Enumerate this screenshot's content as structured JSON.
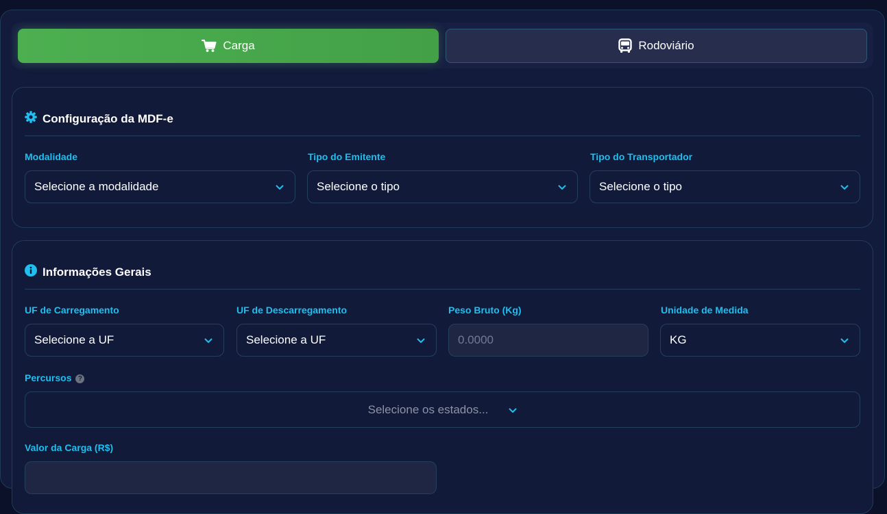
{
  "tabs": [
    {
      "label": "Carga",
      "icon": "cart-icon",
      "active": true
    },
    {
      "label": "Rodoviário",
      "icon": "bus-icon",
      "active": false
    }
  ],
  "config": {
    "title": "Configuração da MDF-e",
    "modalidade": {
      "label": "Modalidade",
      "value": "Selecione a modalidade"
    },
    "tipo_emitente": {
      "label": "Tipo do Emitente",
      "value": "Selecione o tipo"
    },
    "tipo_transportador": {
      "label": "Tipo do Transportador",
      "value": "Selecione o tipo"
    }
  },
  "info": {
    "title": "Informações Gerais",
    "uf_carregamento": {
      "label": "UF de Carregamento",
      "value": "Selecione a UF"
    },
    "uf_descarregamento": {
      "label": "UF de Descarregamento",
      "value": "Selecione a UF"
    },
    "peso_bruto": {
      "label": "Peso Bruto (Kg)",
      "placeholder": "0.0000"
    },
    "unidade_medida": {
      "label": "Unidade de Medida",
      "value": "KG"
    },
    "percursos": {
      "label": "Percursos",
      "help": "?",
      "placeholder": "Selecione os estados..."
    },
    "valor_carga": {
      "label": "Valor da Carga (R$)"
    }
  },
  "colors": {
    "accent_green": "#4caf50",
    "label_cyan": "#1fbfef",
    "background": "#131b3c"
  }
}
